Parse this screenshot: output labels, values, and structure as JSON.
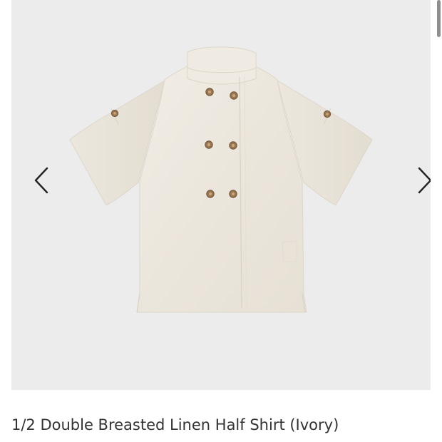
{
  "gallery": {
    "prev_icon": "chevron-left-icon",
    "next_icon": "chevron-right-icon",
    "background_color": "#ececec",
    "garment_color": "#ede8df",
    "button_color": "#9a7650"
  },
  "product": {
    "title": "1/2 Double Breasted Linen Half Shirt (Ivory)"
  },
  "page": {
    "scroll_indicator": "scroll-indicator"
  }
}
